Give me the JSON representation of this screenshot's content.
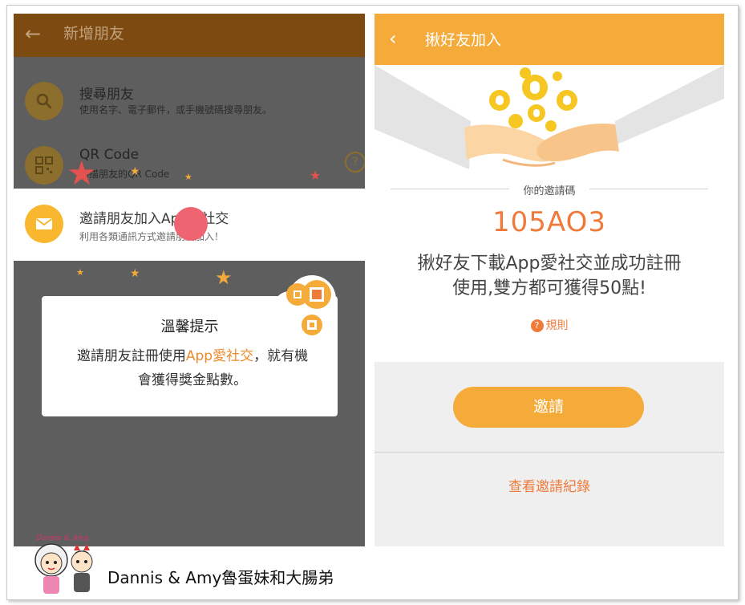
{
  "left_screen": {
    "appbar": {
      "back_icon": "arrow-left-icon",
      "title": "新增朋友"
    },
    "rows": [
      {
        "icon": "search-icon",
        "title": "搜尋朋友",
        "subtitle": "使用名字、電子郵件，或手機號碼搜尋朋友。"
      },
      {
        "icon": "qr-code-icon",
        "title": "QR Code",
        "subtitle": "掃描朋友的QR Code"
      },
      {
        "icon": "mail-icon",
        "title": "邀請朋友加入App愛社交",
        "subtitle": "利用各類通訊方式邀請朋友加入！"
      }
    ],
    "help_icon": "?",
    "tip": {
      "title": "溫馨提示",
      "body_pre": "邀請朋友註冊使用",
      "body_highlight": "App愛社交",
      "body_post": "，就有機會獲得獎金點數。"
    }
  },
  "right_screen": {
    "appbar": {
      "back_icon": "chevron-left-icon",
      "title": "揪好友加入"
    },
    "code_caption": "你的邀請碼",
    "code_value": "105AO3",
    "promo_line1": "揪好友下載App愛社交並成功註冊",
    "promo_line2": "使用,雙方都可獲得50點!",
    "rules_label": "規則",
    "invite_button": "邀請",
    "history_link": "查看邀請紀錄"
  },
  "footer": {
    "credit": "Dannis & Amy魯蛋妹和大腸弟",
    "mascot_sign": "Dannis & Amy"
  },
  "colors": {
    "accent": "#f5ab39",
    "highlight": "#ef7a3a",
    "overlay": "#5e5e5e",
    "dim_appbar": "#7d4a12"
  }
}
